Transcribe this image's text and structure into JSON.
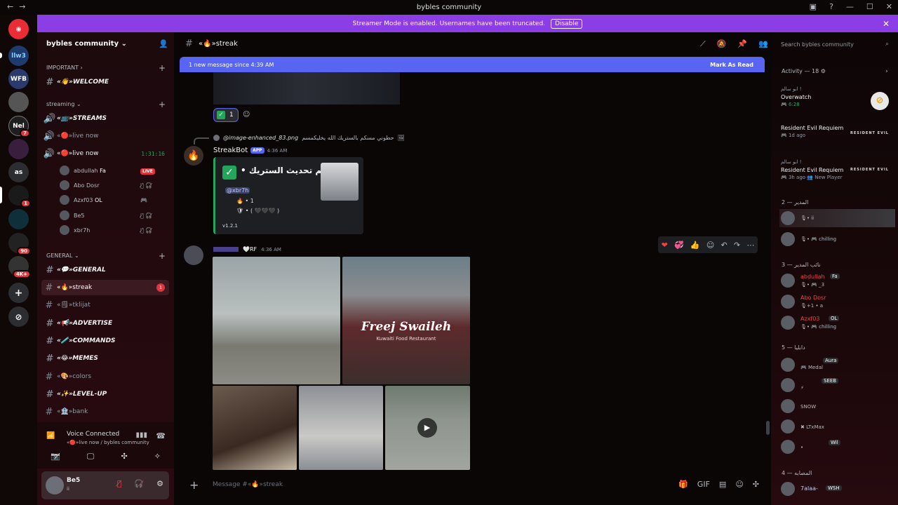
{
  "window": {
    "title": "bybles community"
  },
  "banner": {
    "text": "Streamer Mode is enabled. Usernames have been truncated.",
    "button": "Disable"
  },
  "servers": [
    {
      "label": "",
      "kind": "discord-logo"
    },
    {
      "label": "llw3"
    },
    {
      "label": "WFB"
    },
    {
      "label": ""
    },
    {
      "label": "Nel",
      "badge": "7"
    },
    {
      "label": ""
    },
    {
      "label": "as"
    },
    {
      "label": "",
      "badge": "1"
    },
    {
      "label": ""
    },
    {
      "label": "",
      "badge": "90"
    },
    {
      "label": "",
      "badge": "4K+"
    }
  ],
  "sidebar": {
    "guild_name": "bybles community",
    "categories": {
      "important": "IMPORTANT",
      "streaming": "streaming",
      "general": "GENERAL"
    },
    "channels": {
      "welcome": "«👋»WELCOME",
      "streams": "«📺»STREAMS",
      "livenow1": "«🔴»live now",
      "livenow2": "«🔴»live now",
      "livenow2_time": "1:31:16",
      "general": "«💬»GENERAL",
      "streak": "«🔥»streak",
      "streak_count": "1",
      "tklijat": "«🗒»tklijat",
      "advertise": "«📢»ADVERTISE",
      "commands": "«🧪»COMMANDS",
      "memes": "«😂»MEMES",
      "colors": "«🎨»colors",
      "levelup": "«✨»LEVEL-UP",
      "bank": "«🏦»bank"
    },
    "voice_users": [
      {
        "name": "abdullah",
        "tag": "Fa",
        "live": "LIVE"
      },
      {
        "name": "Abo Dosr"
      },
      {
        "name": "Azxf03",
        "tag": "OL"
      },
      {
        "name": "Be5"
      },
      {
        "name": "xbr7h"
      }
    ],
    "voice_connected": {
      "title": "Voice Connected",
      "subtitle": "«🔴»live now / bybles community"
    },
    "user": {
      "name": "Be5",
      "status": "ii"
    }
  },
  "chat": {
    "channel_name": "«🔥»streak",
    "new_messages": "1 new message since 4:39 AM",
    "mark_as_read": "Mark As Read",
    "reaction_count": "1",
    "reply_file": "@image-enhanced_83.png",
    "reply_text": "حطوني مسكم بالستريك الله يخليكمسم",
    "bot_name": "StreakBot",
    "bot_tag": "APP",
    "bot_time": "4:36 AM",
    "embed": {
      "title": "تم تحديث الستريك •",
      "mention": "@xbr7h",
      "line1": "🔥 • 1",
      "line2": "🛡 • ( 🖤🖤🖤 )",
      "version": "v1.2.1"
    },
    "user_msg_tag": "RF",
    "user_msg_time": "4:36 AM",
    "photo_sign": "Freej Swaileh",
    "photo_sign_sub": "Kuwaiti Food Restaurant",
    "placeholder": "Message #«🔥»streak"
  },
  "right": {
    "search_placeholder": "Search bybles community",
    "activity_header": "Activity — 18",
    "activities": [
      {
        "who": "ابو سالم !",
        "game": "Overwatch",
        "detail": "🎮 6:28",
        "logo": "overwatch"
      },
      {
        "who": "",
        "game": "Resident Evil Requiem",
        "detail": "🎮 1d ago",
        "logo": "resident-evil"
      },
      {
        "who": "ابو سالم !",
        "game": "Resident Evil Requiem",
        "detail": "🎮 3h ago  👥 New Player",
        "logo": "resident-evil"
      }
    ],
    "groups": [
      {
        "header": "المدير — 2",
        "members": [
          {
            "name": "",
            "status": "🎙• ii"
          },
          {
            "name": "",
            "status": "🎙• 🎮 chilling"
          }
        ]
      },
      {
        "header": "نائب المدير — 3",
        "members": [
          {
            "name": "abdullah",
            "tag": "Fa",
            "status": "🎙• 🎮 _3"
          },
          {
            "name": "Abo Dosr",
            "status": "🎙+1 •    a"
          },
          {
            "name": "Azxf03",
            "tag": "OL",
            "status": "🎙• 🎮 chilling"
          }
        ]
      },
      {
        "header": "دابليا — 5",
        "members": [
          {
            "name": "",
            "tag": "Aura",
            "status": "🎮 Medal"
          },
          {
            "name": "",
            "tag": "SEEB",
            "status": "⚡"
          },
          {
            "name": "",
            "status": "SNOW"
          },
          {
            "name": "",
            "status": "✖ LTxMax"
          },
          {
            "name": "",
            "tag": "Wil",
            "status": "•"
          }
        ]
      },
      {
        "header": "المصابه — 4",
        "members": [
          {
            "name": "7alaa-",
            "tag": "WSH",
            "status": ""
          }
        ]
      }
    ]
  },
  "colors": {
    "accent": "#5865f2",
    "banner": "#8c3ee6",
    "online": "#23a55a",
    "danger": "#da373c"
  }
}
